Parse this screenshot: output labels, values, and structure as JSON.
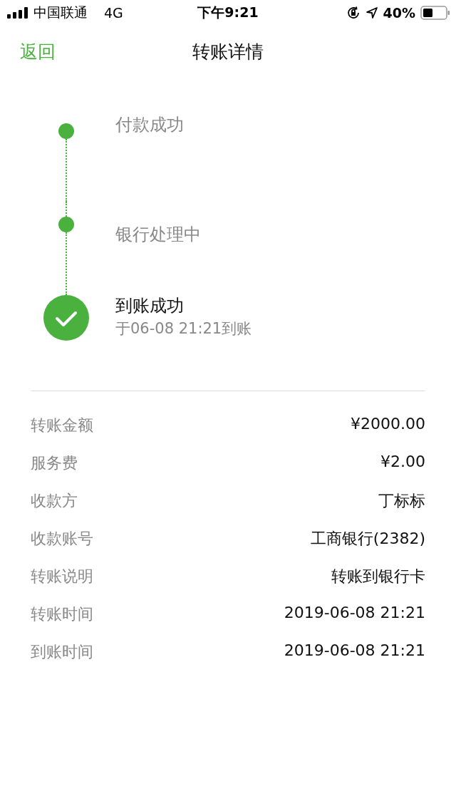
{
  "status_bar": {
    "carrier": "中国联通",
    "network": "4G",
    "time": "下午9:21",
    "battery": "40%"
  },
  "nav": {
    "back": "返回",
    "title": "转账详情"
  },
  "steps": [
    {
      "kind": "dot",
      "label": "付款成功"
    },
    {
      "kind": "dot",
      "label": "银行处理中"
    },
    {
      "kind": "done",
      "label": "到账成功",
      "note": "于06-08 21:21到账"
    }
  ],
  "details": [
    {
      "label": "转账金额",
      "value": "¥2000.00"
    },
    {
      "label": "服务费",
      "value": "¥2.00"
    },
    {
      "label": "收款方",
      "value": "丁标标"
    },
    {
      "label": "收款账号",
      "value": "工商银行(2382)"
    },
    {
      "label": "转账说明",
      "value": "转账到银行卡"
    },
    {
      "label": "转账时间",
      "value": "2019-06-08 21:21"
    },
    {
      "label": "到账时间",
      "value": "2019-06-08 21:21"
    }
  ]
}
